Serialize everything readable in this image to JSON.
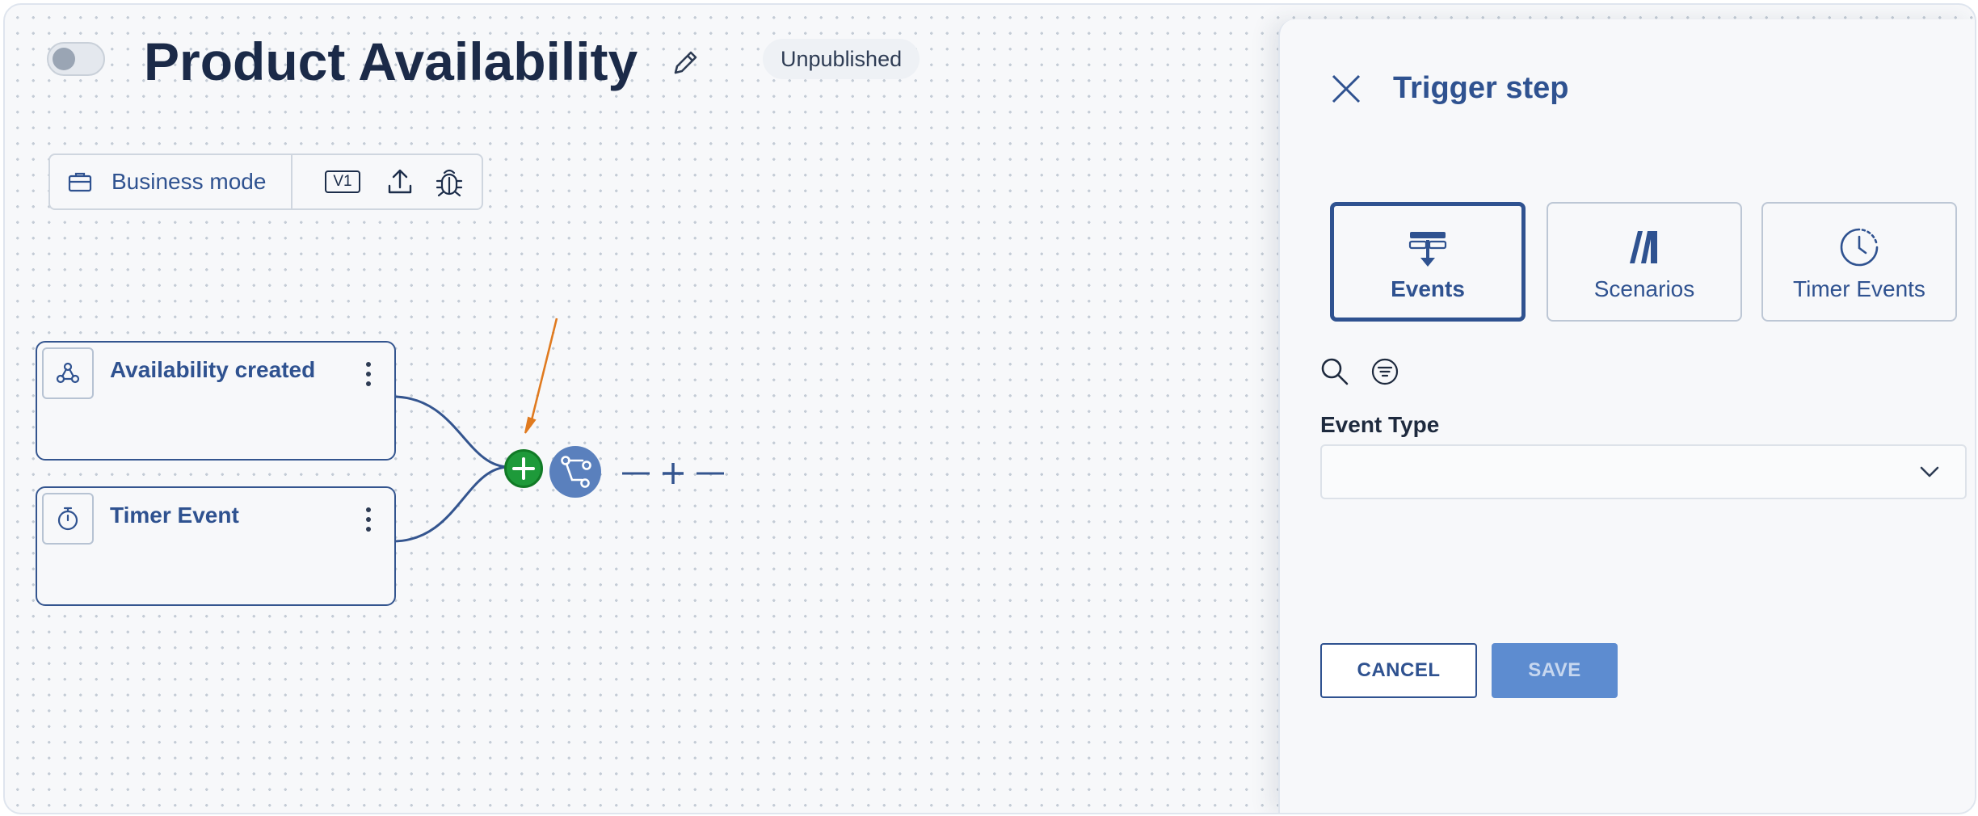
{
  "header": {
    "title": "Product Availability",
    "status": "Unpublished",
    "enabled": false
  },
  "toolbar": {
    "mode_label": "Business mode",
    "version": "V1"
  },
  "nodes": [
    {
      "title": "Availability created",
      "icon": "webhook-icon"
    },
    {
      "title": "Timer Event",
      "icon": "stopwatch-icon"
    }
  ],
  "panel": {
    "title": "Trigger step",
    "types": [
      {
        "label": "Events",
        "icon": "events-icon",
        "selected": true
      },
      {
        "label": "Scenarios",
        "icon": "scenarios-icon",
        "selected": false
      },
      {
        "label": "Timer Events",
        "icon": "timer-icon",
        "selected": false
      }
    ],
    "field_label": "Event Type",
    "field_value": "",
    "cancel_label": "CANCEL",
    "save_label": "SAVE"
  },
  "colors": {
    "primary": "#2f5290",
    "add_green": "#1e9a3a",
    "merge_blue": "#5a80bd",
    "annotation_orange": "#e07a1f",
    "save_disabled": "#5d8cd0"
  }
}
